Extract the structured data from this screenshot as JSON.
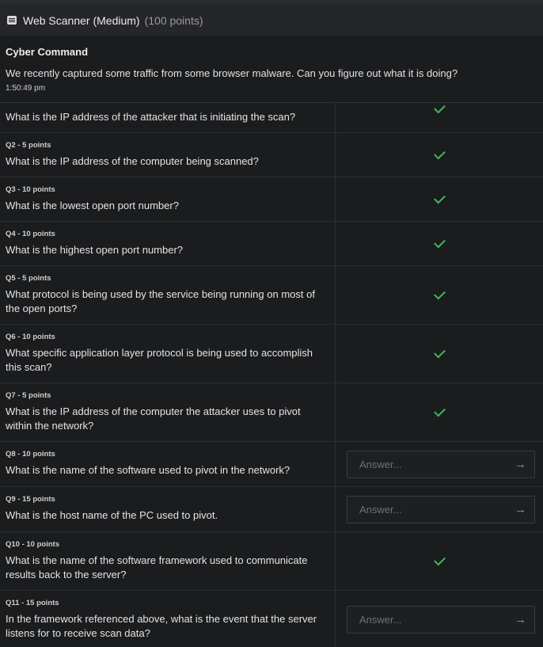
{
  "header": {
    "title": "Web Scanner (Medium)",
    "points": "(100 points)",
    "icon": "list-icon"
  },
  "intro": {
    "org": "Cyber Command",
    "description": "We recently captured some traffic from some browser malware. Can you figure out what it is doing?",
    "time": "1:50:49 pm"
  },
  "answer_placeholder": "Answer...",
  "colors": {
    "check": "#3dbb5e",
    "background": "#1b1c1e"
  },
  "questions": [
    {
      "points": "",
      "text": "What is the IP address of the attacker that is initiating the scan?",
      "status": "solved"
    },
    {
      "points": "Q2 - 5 points",
      "text": "What is the IP address of the computer being scanned?",
      "status": "solved"
    },
    {
      "points": "Q3 - 10 points",
      "text": "What is the lowest open port number?",
      "status": "solved"
    },
    {
      "points": "Q4 - 10 points",
      "text": "What is the highest open port number?",
      "status": "solved"
    },
    {
      "points": "Q5 - 5 points",
      "text": "What protocol is being used by the service being running on most of the open ports?",
      "status": "solved"
    },
    {
      "points": "Q6 - 10 points",
      "text": "What specific application layer protocol is being used to accomplish this scan?",
      "status": "solved"
    },
    {
      "points": "Q7 - 5 points",
      "text": "What is the IP address of the computer the attacker uses to pivot within the network?",
      "status": "solved"
    },
    {
      "points": "Q8 - 10 points",
      "text": "What is the name of the software used to pivot in the network?",
      "status": "open"
    },
    {
      "points": "Q9 - 15 points",
      "text": "What is the host name of the PC used to pivot.",
      "status": "open"
    },
    {
      "points": "Q10 - 10 points",
      "text": "What is the name of the software framework used to communicate results back to the server?",
      "status": "solved"
    },
    {
      "points": "Q11 - 15 points",
      "text": "In the framework referenced above, what is the event that the server listens for to receive scan data?",
      "status": "open"
    }
  ]
}
